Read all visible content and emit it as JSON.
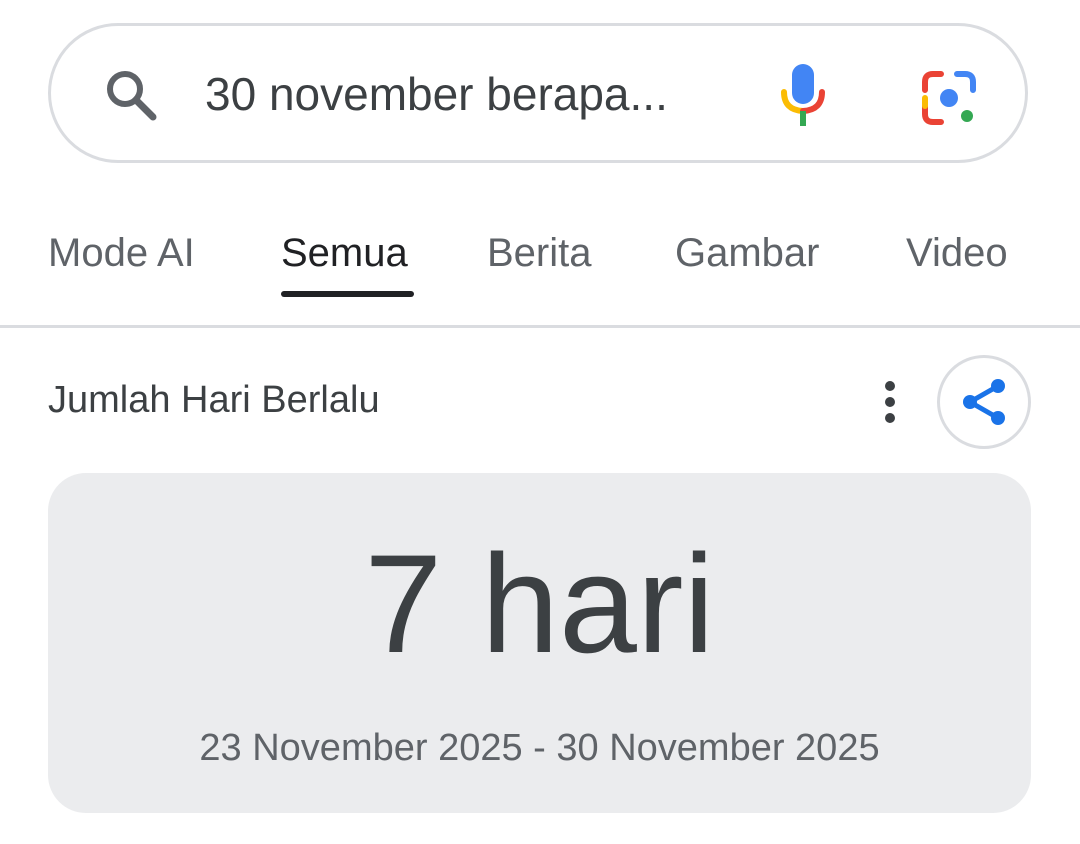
{
  "search": {
    "query": "30 november berapa...",
    "icons": [
      "search-icon",
      "mic-icon",
      "google-lens-icon"
    ]
  },
  "tabs": [
    {
      "label": "Mode AI",
      "active": false
    },
    {
      "label": "Semua",
      "active": true
    },
    {
      "label": "Berita",
      "active": false
    },
    {
      "label": "Gambar",
      "active": false
    },
    {
      "label": "Video",
      "active": false
    }
  ],
  "card": {
    "title": "Jumlah Hari Berlalu",
    "icons": [
      "more-vert-icon",
      "share-icon"
    ],
    "result": "7 hari",
    "range": "23 November 2025 - 30 November 2025"
  },
  "colors": {
    "google_blue": "#4285f4",
    "google_red": "#ea4335",
    "google_yellow": "#fbbc04",
    "google_green": "#34a853",
    "share_blue": "#1a73e8",
    "card_background": "#ebecee"
  }
}
